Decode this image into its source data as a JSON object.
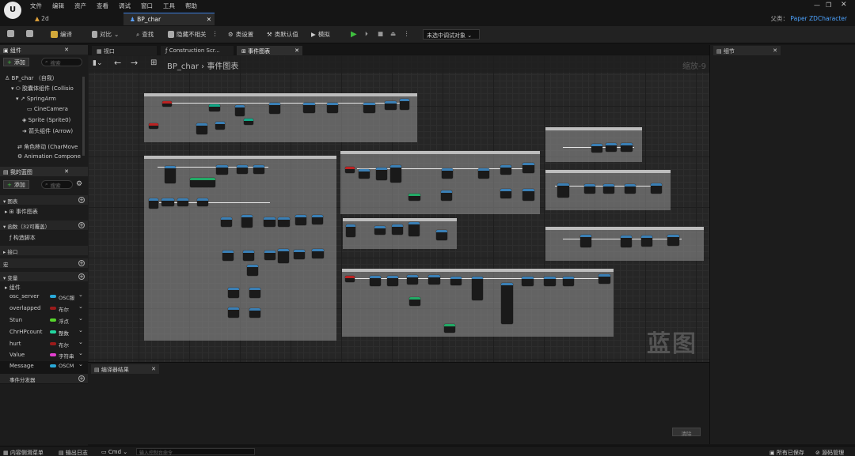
{
  "menubar": {
    "items": [
      "文件",
      "编辑",
      "资产",
      "查看",
      "调试",
      "窗口",
      "工具",
      "帮助"
    ],
    "parent_label": "父类：",
    "parent_value": "Paper ZDCharacter"
  },
  "doc_tabs": [
    {
      "label": "2d"
    },
    {
      "label": "BP_char"
    }
  ],
  "toolbar": {
    "compile": "编译",
    "diff": "对比",
    "find": "查找",
    "hide_unrelated": "隐藏不相关",
    "class_settings": "类设置",
    "class_defaults": "类默认值",
    "simulate": "模拟",
    "debug_object": "未选中调试对象"
  },
  "components_panel": {
    "title": "组件",
    "add": "添加",
    "search_placeholder": "搜索",
    "tree": [
      "BP_char （自我）",
      "胶囊体组件 (Collisio",
      "SpringArm",
      "CineCamera",
      "Sprite (Sprite0)",
      "箭头组件 (Arrow)",
      "角色移动 (CharMove",
      "Animation Compone"
    ]
  },
  "mybp_panel": {
    "title": "我的蓝图",
    "add": "添加",
    "search_placeholder": "搜索",
    "sections": {
      "graphs": "图表",
      "event_graph": "事件图表",
      "functions": "函数（32可覆盖）",
      "construction": "构造脚本",
      "interfaces": "接口",
      "macros": "宏",
      "variables": "变量",
      "components": "组件",
      "dispatchers": "事件分发器"
    },
    "variables": [
      {
        "name": "osc_server",
        "type": "OSC服",
        "color": "#2aa9d8"
      },
      {
        "name": "overlapped",
        "type": "布尔",
        "color": "#9b1b1b"
      },
      {
        "name": "Stun",
        "type": "浮点",
        "color": "#57d62c"
      },
      {
        "name": "ChrHPcount",
        "type": "整数",
        "color": "#23d6a0"
      },
      {
        "name": "hurt",
        "type": "布尔",
        "color": "#9b1b1b"
      },
      {
        "name": "Value",
        "type": "字符串",
        "color": "#e43fd0"
      },
      {
        "name": "Message",
        "type": "OSCM",
        "color": "#2aa9d8"
      }
    ]
  },
  "graph_tabs": [
    {
      "label": "视口"
    },
    {
      "label": "Construction Scr..."
    },
    {
      "label": "事件图表"
    }
  ],
  "graph": {
    "breadcrumb_root": "BP_char",
    "breadcrumb_leaf": "事件图表",
    "zoom": "缩放-9",
    "watermark": "蓝图"
  },
  "details_panel": {
    "title": "细节"
  },
  "compiler_panel": {
    "title": "编译器结果",
    "clear": "清除"
  },
  "statusbar": {
    "content_drawer": "内容侧滑菜单",
    "output_log": "输出日志",
    "cmd": "Cmd",
    "console_placeholder": "输入控制台命令",
    "all_saved": "所有已保存",
    "source_control": "源码管理"
  }
}
